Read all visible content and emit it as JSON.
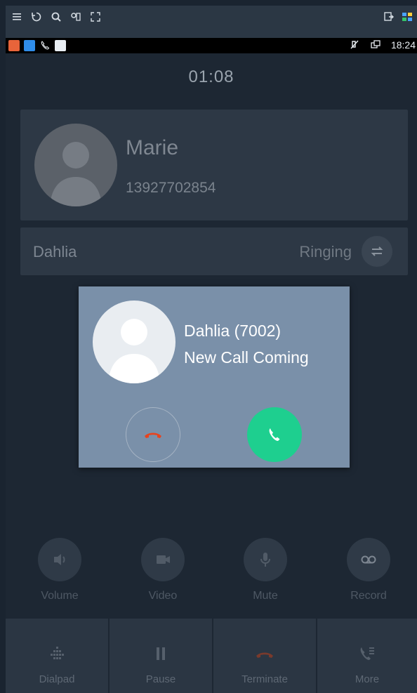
{
  "topbar": {
    "left_icons": [
      "menu-icon",
      "refresh-icon",
      "search-icon",
      "settings-icon",
      "expand-icon"
    ],
    "right_icons": [
      "screen-icon",
      "apps-icon"
    ]
  },
  "statusbar": {
    "notification_icons": [
      "missed-call-icon",
      "call-icon",
      "phone-icon",
      "sim-icon"
    ],
    "time": "18:24"
  },
  "call": {
    "timer": "01:08",
    "caller_name": "Marie",
    "caller_number": "13927702854",
    "line_name": "Dahlia",
    "line_status": "Ringing"
  },
  "incoming": {
    "name": "Dahlia (7002)",
    "message": "New Call Coming"
  },
  "actions": [
    {
      "label": "Volume",
      "icon": "volume-icon"
    },
    {
      "label": "Video",
      "icon": "video-icon"
    },
    {
      "label": "Mute",
      "icon": "mic-icon"
    },
    {
      "label": "Record",
      "icon": "record-icon"
    }
  ],
  "tabs": [
    {
      "label": "Dialpad",
      "icon": "dialpad-icon"
    },
    {
      "label": "Pause",
      "icon": "pause-icon"
    },
    {
      "label": "Terminate",
      "icon": "hangup-icon"
    },
    {
      "label": "More",
      "icon": "more-icon"
    }
  ],
  "colors": {
    "accept": "#1ecf8f",
    "reject": "#e8431d",
    "dialog": "#7a90a9",
    "background": "#1d2733"
  }
}
